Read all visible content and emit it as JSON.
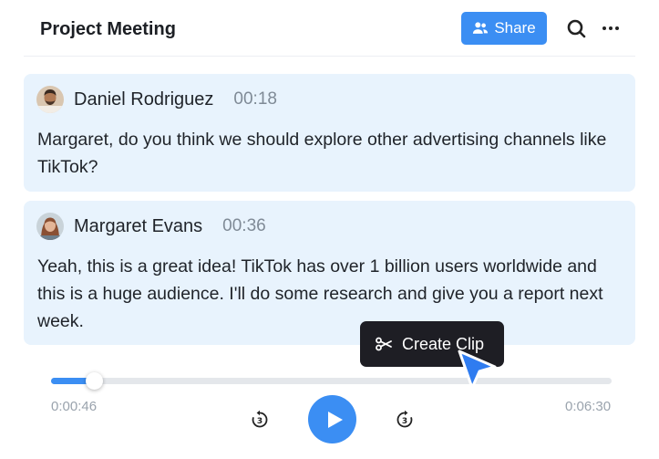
{
  "header": {
    "title": "Project Meeting",
    "share_label": "Share"
  },
  "transcript": [
    {
      "speaker": "Daniel Rodriguez",
      "time": "00:18",
      "text": "Margaret, do you think we should explore other advertising channels like TikTok?"
    },
    {
      "speaker": "Margaret Evans",
      "time": "00:36",
      "text": "Yeah, this is a great idea! TikTok has over 1 billion users worldwide and this is a huge audience. I'll do some research and give you a report next week."
    }
  ],
  "tooltip": {
    "label": "Create Clip"
  },
  "player": {
    "current_time": "0:00:46",
    "total_time": "0:06:30",
    "progress_fraction": 0.064,
    "skip_back_seconds": "3",
    "skip_forward_seconds": "3"
  },
  "colors": {
    "accent": "#3b8ef3",
    "card_bg": "#e8f3fd",
    "tooltip_bg": "#1e1e24"
  }
}
